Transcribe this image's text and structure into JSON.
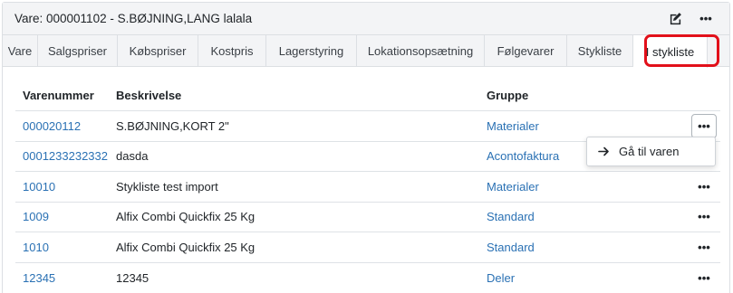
{
  "header": {
    "title": "Vare: 000001102 - S.BØJNING,LANG lalala",
    "edit_icon": "edit-icon",
    "more_icon": "more-horizontal-icon"
  },
  "tabs": [
    {
      "label": "Vare"
    },
    {
      "label": "Salgspriser"
    },
    {
      "label": "Købspriser"
    },
    {
      "label": "Kostpris"
    },
    {
      "label": "Lagerstyring"
    },
    {
      "label": "Lokationsopsætning"
    },
    {
      "label": "Følgevarer"
    },
    {
      "label": "Stykliste"
    },
    {
      "label": "I stykliste"
    }
  ],
  "active_tab": "I stykliste",
  "table": {
    "headers": {
      "number": "Varenummer",
      "description": "Beskrivelse",
      "group": "Gruppe"
    },
    "rows": [
      {
        "number": "000020112",
        "description": "S.BØJNING,KORT 2\"",
        "group": "Materialer",
        "actions": "•••"
      },
      {
        "number": "0001233232332",
        "description": "dasda",
        "group": "Acontofaktura",
        "actions": "•••"
      },
      {
        "number": "10010",
        "description": "Stykliste test import",
        "group": "Materialer",
        "actions": "•••"
      },
      {
        "number": "1009",
        "description": "Alfix Combi Quickfix 25 Kg",
        "group": "Standard",
        "actions": "•••"
      },
      {
        "number": "1010",
        "description": "Alfix Combi Quickfix 25 Kg",
        "group": "Standard",
        "actions": "•••"
      },
      {
        "number": "12345",
        "description": "12345",
        "group": "Deler",
        "actions": "•••"
      }
    ]
  },
  "dropdown": {
    "item_label": "Gå til varen",
    "item_icon": "arrow-right-icon"
  },
  "colors": {
    "link": "#2a71b4",
    "highlight": "#e2101a",
    "header_bg": "#f3f4f6"
  }
}
